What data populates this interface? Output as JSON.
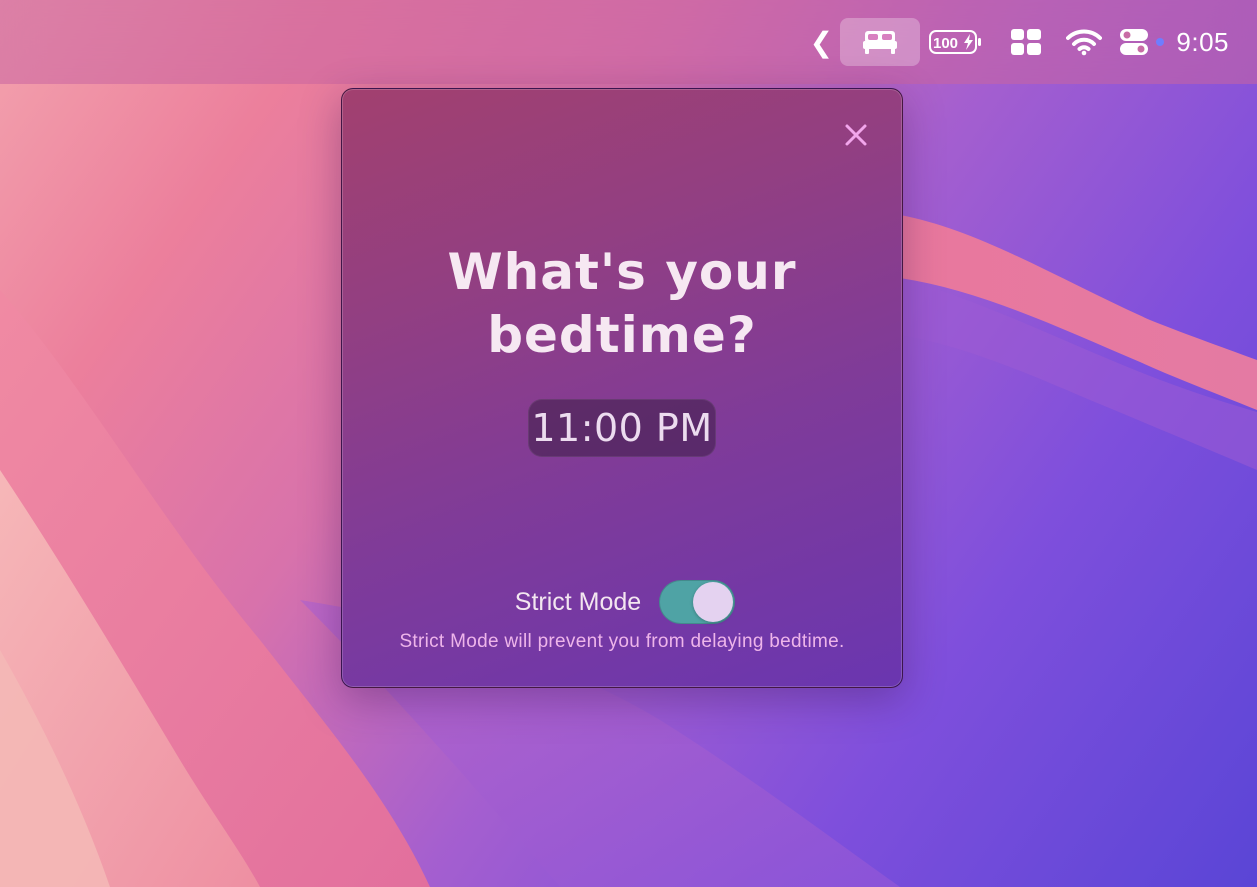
{
  "menubar": {
    "chevron_glyph": "❮",
    "battery_label": "100",
    "clock": "9:05",
    "icons": [
      "chevron-left-icon",
      "bed-icon",
      "battery-charging-icon",
      "window-grid-icon",
      "wifi-icon",
      "control-center-icon",
      "status-dot-icon"
    ]
  },
  "popup": {
    "title_line1": "What's your",
    "title_line2": "bedtime?",
    "bedtime_value": "11:00 PM",
    "strict_mode_label": "Strict Mode",
    "strict_mode_on": true,
    "strict_mode_description": "Strict Mode will prevent you from delaying bedtime.",
    "close_icon": "close-icon"
  },
  "colors": {
    "toggle_on": "#4fa3a5",
    "description_text": "#eeb5ea",
    "close_icon": "#f2a6ec"
  }
}
